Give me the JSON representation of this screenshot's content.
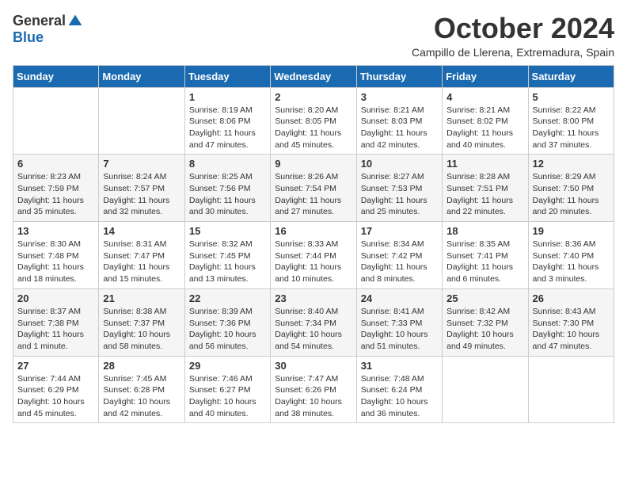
{
  "logo": {
    "general": "General",
    "blue": "Blue"
  },
  "title": "October 2024",
  "location": "Campillo de Llerena, Extremadura, Spain",
  "days_of_week": [
    "Sunday",
    "Monday",
    "Tuesday",
    "Wednesday",
    "Thursday",
    "Friday",
    "Saturday"
  ],
  "weeks": [
    [
      {
        "day": "",
        "info": ""
      },
      {
        "day": "",
        "info": ""
      },
      {
        "day": "1",
        "info": "Sunrise: 8:19 AM\nSunset: 8:06 PM\nDaylight: 11 hours and 47 minutes."
      },
      {
        "day": "2",
        "info": "Sunrise: 8:20 AM\nSunset: 8:05 PM\nDaylight: 11 hours and 45 minutes."
      },
      {
        "day": "3",
        "info": "Sunrise: 8:21 AM\nSunset: 8:03 PM\nDaylight: 11 hours and 42 minutes."
      },
      {
        "day": "4",
        "info": "Sunrise: 8:21 AM\nSunset: 8:02 PM\nDaylight: 11 hours and 40 minutes."
      },
      {
        "day": "5",
        "info": "Sunrise: 8:22 AM\nSunset: 8:00 PM\nDaylight: 11 hours and 37 minutes."
      }
    ],
    [
      {
        "day": "6",
        "info": "Sunrise: 8:23 AM\nSunset: 7:59 PM\nDaylight: 11 hours and 35 minutes."
      },
      {
        "day": "7",
        "info": "Sunrise: 8:24 AM\nSunset: 7:57 PM\nDaylight: 11 hours and 32 minutes."
      },
      {
        "day": "8",
        "info": "Sunrise: 8:25 AM\nSunset: 7:56 PM\nDaylight: 11 hours and 30 minutes."
      },
      {
        "day": "9",
        "info": "Sunrise: 8:26 AM\nSunset: 7:54 PM\nDaylight: 11 hours and 27 minutes."
      },
      {
        "day": "10",
        "info": "Sunrise: 8:27 AM\nSunset: 7:53 PM\nDaylight: 11 hours and 25 minutes."
      },
      {
        "day": "11",
        "info": "Sunrise: 8:28 AM\nSunset: 7:51 PM\nDaylight: 11 hours and 22 minutes."
      },
      {
        "day": "12",
        "info": "Sunrise: 8:29 AM\nSunset: 7:50 PM\nDaylight: 11 hours and 20 minutes."
      }
    ],
    [
      {
        "day": "13",
        "info": "Sunrise: 8:30 AM\nSunset: 7:48 PM\nDaylight: 11 hours and 18 minutes."
      },
      {
        "day": "14",
        "info": "Sunrise: 8:31 AM\nSunset: 7:47 PM\nDaylight: 11 hours and 15 minutes."
      },
      {
        "day": "15",
        "info": "Sunrise: 8:32 AM\nSunset: 7:45 PM\nDaylight: 11 hours and 13 minutes."
      },
      {
        "day": "16",
        "info": "Sunrise: 8:33 AM\nSunset: 7:44 PM\nDaylight: 11 hours and 10 minutes."
      },
      {
        "day": "17",
        "info": "Sunrise: 8:34 AM\nSunset: 7:42 PM\nDaylight: 11 hours and 8 minutes."
      },
      {
        "day": "18",
        "info": "Sunrise: 8:35 AM\nSunset: 7:41 PM\nDaylight: 11 hours and 6 minutes."
      },
      {
        "day": "19",
        "info": "Sunrise: 8:36 AM\nSunset: 7:40 PM\nDaylight: 11 hours and 3 minutes."
      }
    ],
    [
      {
        "day": "20",
        "info": "Sunrise: 8:37 AM\nSunset: 7:38 PM\nDaylight: 11 hours and 1 minute."
      },
      {
        "day": "21",
        "info": "Sunrise: 8:38 AM\nSunset: 7:37 PM\nDaylight: 10 hours and 58 minutes."
      },
      {
        "day": "22",
        "info": "Sunrise: 8:39 AM\nSunset: 7:36 PM\nDaylight: 10 hours and 56 minutes."
      },
      {
        "day": "23",
        "info": "Sunrise: 8:40 AM\nSunset: 7:34 PM\nDaylight: 10 hours and 54 minutes."
      },
      {
        "day": "24",
        "info": "Sunrise: 8:41 AM\nSunset: 7:33 PM\nDaylight: 10 hours and 51 minutes."
      },
      {
        "day": "25",
        "info": "Sunrise: 8:42 AM\nSunset: 7:32 PM\nDaylight: 10 hours and 49 minutes."
      },
      {
        "day": "26",
        "info": "Sunrise: 8:43 AM\nSunset: 7:30 PM\nDaylight: 10 hours and 47 minutes."
      }
    ],
    [
      {
        "day": "27",
        "info": "Sunrise: 7:44 AM\nSunset: 6:29 PM\nDaylight: 10 hours and 45 minutes."
      },
      {
        "day": "28",
        "info": "Sunrise: 7:45 AM\nSunset: 6:28 PM\nDaylight: 10 hours and 42 minutes."
      },
      {
        "day": "29",
        "info": "Sunrise: 7:46 AM\nSunset: 6:27 PM\nDaylight: 10 hours and 40 minutes."
      },
      {
        "day": "30",
        "info": "Sunrise: 7:47 AM\nSunset: 6:26 PM\nDaylight: 10 hours and 38 minutes."
      },
      {
        "day": "31",
        "info": "Sunrise: 7:48 AM\nSunset: 6:24 PM\nDaylight: 10 hours and 36 minutes."
      },
      {
        "day": "",
        "info": ""
      },
      {
        "day": "",
        "info": ""
      }
    ]
  ]
}
